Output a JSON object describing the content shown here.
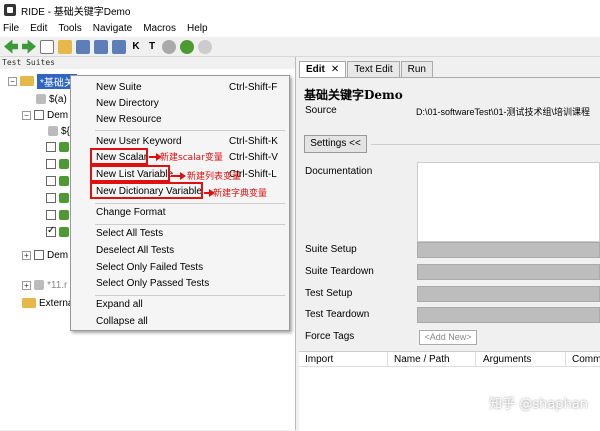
{
  "window": {
    "title": "RIDE - 基础关键字Demo"
  },
  "menu": [
    "File",
    "Edit",
    "Tools",
    "Navigate",
    "Macros",
    "Help"
  ],
  "tree": {
    "header": "Test Suites",
    "rows": [
      {
        "label": "*基础关"
      },
      {
        "label": "$(a)"
      },
      {
        "label": "Dem"
      },
      {
        "label": "${"
      },
      {
        "label": "Dem"
      },
      {
        "label": "*11.r"
      },
      {
        "label": "Externa"
      }
    ]
  },
  "context_menu": {
    "items": [
      {
        "label": "New Suite",
        "shortcut": "Ctrl-Shift-F"
      },
      {
        "label": "New Directory",
        "shortcut": ""
      },
      {
        "label": "New Resource",
        "shortcut": ""
      },
      {
        "label": "New User Keyword",
        "shortcut": "Ctrl-Shift-K"
      },
      {
        "label": "New Scalar",
        "shortcut": "Ctrl-Shift-V"
      },
      {
        "label": "New List Variable",
        "shortcut": "Ctrl-Shift-L"
      },
      {
        "label": "New Dictionary Variable",
        "shortcut": ""
      },
      {
        "label": "Change Format",
        "shortcut": ""
      },
      {
        "label": "Select All Tests",
        "shortcut": ""
      },
      {
        "label": "Deselect All Tests",
        "shortcut": ""
      },
      {
        "label": "Select Only Failed Tests",
        "shortcut": ""
      },
      {
        "label": "Select Only Passed Tests",
        "shortcut": ""
      },
      {
        "label": "Expand all",
        "shortcut": ""
      },
      {
        "label": "Collapse all",
        "shortcut": ""
      }
    ]
  },
  "annotations": {
    "scalar": "新建scalar变量",
    "list": "新建列表变量",
    "dict": "新建字典变量"
  },
  "tabs": [
    {
      "label": "Edit",
      "close": "✕"
    },
    {
      "label": "Text Edit"
    },
    {
      "label": "Run"
    }
  ],
  "editor": {
    "suite_name": "基础关键字Demo",
    "source_label": "Source",
    "source_value": "D:\\01-softwareTest\\01-测试技术组\\培训课程",
    "settings_button": "Settings <<",
    "documentation_label": "Documentation",
    "suite_setup_label": "Suite Setup",
    "suite_teardown_label": "Suite Teardown",
    "test_setup_label": "Test Setup",
    "test_teardown_label": "Test Teardown",
    "force_tags_label": "Force Tags",
    "add_new": "<Add New>",
    "table_headers": [
      "Import",
      "Name / Path",
      "Arguments",
      "Comm"
    ]
  },
  "watermark": "知乎 @shaphan"
}
